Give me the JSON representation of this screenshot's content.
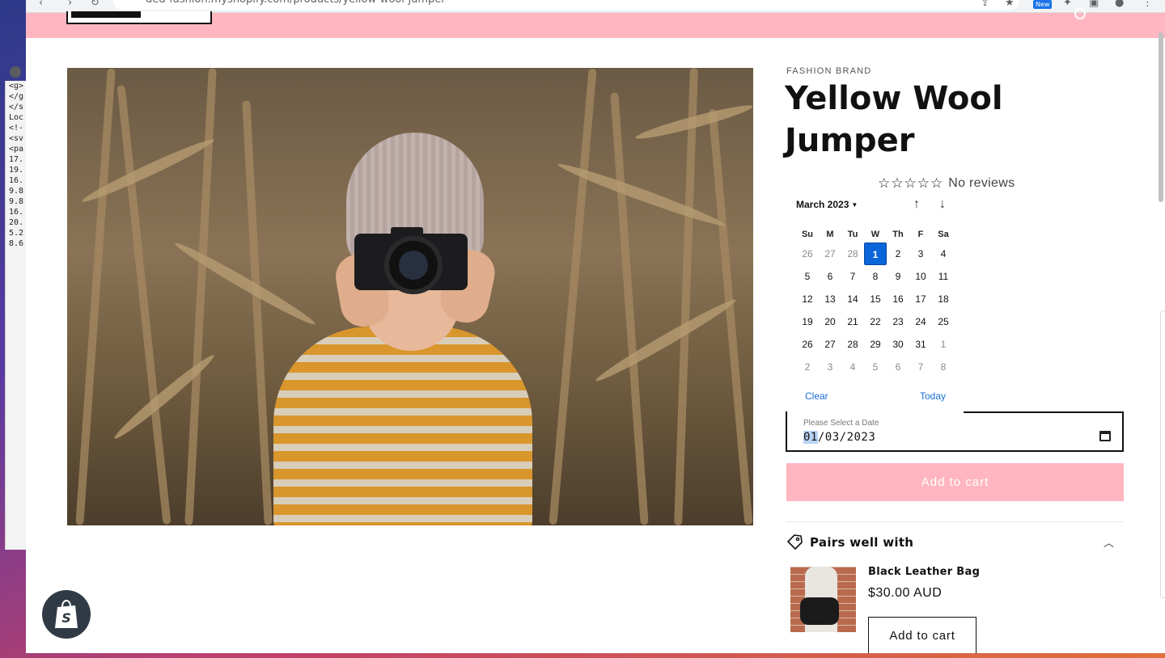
{
  "browser": {
    "url": "ded-fashion.myshopify.com/products/yellow-wool-jumper",
    "new_badge": "New"
  },
  "devtools_bg": {
    "lines": [
      "<g>",
      "",
      "</g",
      "</s",
      "",
      "Loc",
      "<!-",
      "<sv",
      "<pa",
      "17.",
      "19.",
      "16.",
      "9.8",
      "9.8",
      "16.",
      "20.",
      "5.2",
      "8.6"
    ]
  },
  "product": {
    "brand": "FASHION BRAND",
    "title": "Yellow Wool Jumper",
    "reviews_text": "No reviews",
    "stars": [
      "☆",
      "☆",
      "☆",
      "☆",
      "☆"
    ]
  },
  "datepicker": {
    "month_label": "March 2023",
    "weekdays": [
      "Su",
      "M",
      "Tu",
      "W",
      "Th",
      "F",
      "Sa"
    ],
    "days": [
      {
        "d": "26",
        "muted": true
      },
      {
        "d": "27",
        "muted": true
      },
      {
        "d": "28",
        "muted": true
      },
      {
        "d": "1",
        "selected": true
      },
      {
        "d": "2"
      },
      {
        "d": "3"
      },
      {
        "d": "4"
      },
      {
        "d": "5"
      },
      {
        "d": "6"
      },
      {
        "d": "7"
      },
      {
        "d": "8"
      },
      {
        "d": "9"
      },
      {
        "d": "10"
      },
      {
        "d": "11"
      },
      {
        "d": "12"
      },
      {
        "d": "13"
      },
      {
        "d": "14"
      },
      {
        "d": "15"
      },
      {
        "d": "16"
      },
      {
        "d": "17"
      },
      {
        "d": "18"
      },
      {
        "d": "19"
      },
      {
        "d": "20"
      },
      {
        "d": "21"
      },
      {
        "d": "22"
      },
      {
        "d": "23"
      },
      {
        "d": "24"
      },
      {
        "d": "25"
      },
      {
        "d": "26"
      },
      {
        "d": "27"
      },
      {
        "d": "28"
      },
      {
        "d": "29"
      },
      {
        "d": "30"
      },
      {
        "d": "31"
      },
      {
        "d": "1",
        "muted": true
      },
      {
        "d": "2",
        "muted": true
      },
      {
        "d": "3",
        "muted": true
      },
      {
        "d": "4",
        "muted": true
      },
      {
        "d": "5",
        "muted": true
      },
      {
        "d": "6",
        "muted": true
      },
      {
        "d": "7",
        "muted": true
      },
      {
        "d": "8",
        "muted": true
      }
    ],
    "clear_label": "Clear",
    "today_label": "Today"
  },
  "date_field": {
    "label": "Please Select a Date",
    "day": "01",
    "rest": "/03/2023"
  },
  "cart": {
    "add_label": "Add to cart"
  },
  "pairs": {
    "title": "Pairs well with",
    "item_name": "Black Leather Bag",
    "item_price": "$30.00 AUD",
    "item_add_label": "Add to cart"
  },
  "colors": {
    "header_pink": "#ffb6c1",
    "selected_blue": "#0a66d8",
    "link_blue": "#1a6fd8"
  }
}
